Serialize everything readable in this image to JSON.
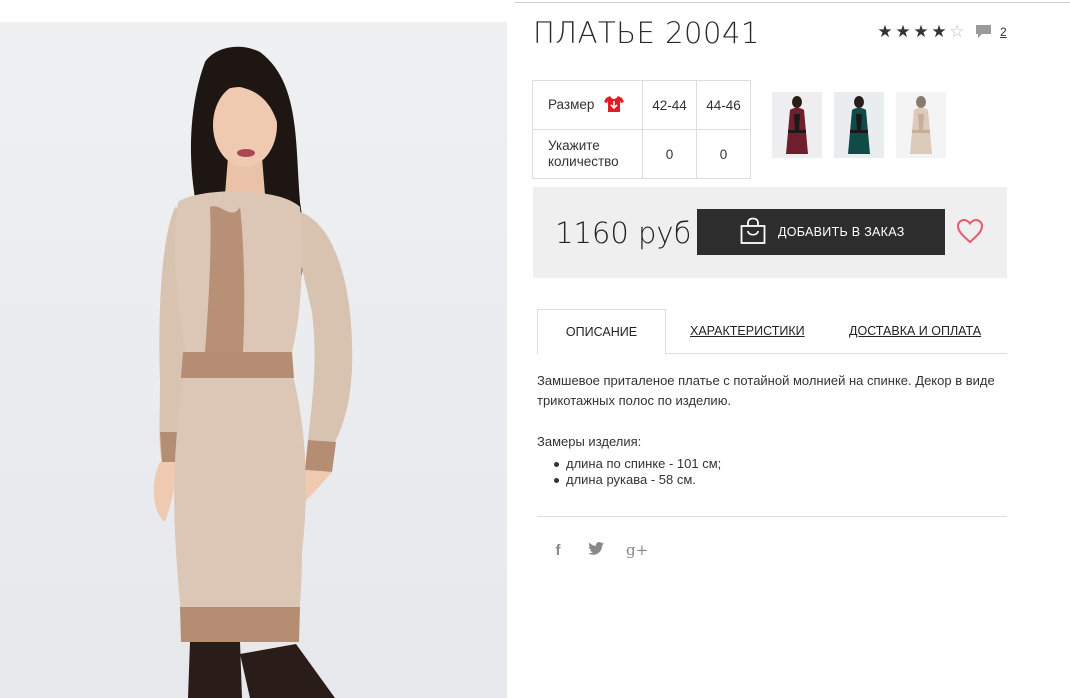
{
  "product": {
    "title": "ПЛАТЬЕ 20041",
    "rating": 4,
    "rating_max": 5,
    "comments_count": "2"
  },
  "size_table": {
    "size_label": "Размер",
    "sizes": [
      "42-44",
      "44-46"
    ],
    "quantity_label_line1": "Укажите",
    "quantity_label_line2": "количество",
    "quantities": [
      "0",
      "0"
    ]
  },
  "thumbnails": [
    {
      "name": "burgundy-dress",
      "color": "#6e1e2c"
    },
    {
      "name": "green-dress",
      "color": "#114b48"
    },
    {
      "name": "beige-dress",
      "color": "#d9c8b6"
    }
  ],
  "purchase": {
    "price": "1160 руб",
    "add_button_label": "ДОБАВИТЬ В ЗАКАЗ",
    "wishlist_icon": "heart-icon",
    "accent_color": "#e25a6e"
  },
  "tabs": [
    {
      "label": "ОПИСАНИЕ",
      "active": true
    },
    {
      "label": "ХАРАКТЕРИСТИКИ",
      "active": false
    },
    {
      "label": "ДОСТАВКА И ОПЛАТА",
      "active": false
    }
  ],
  "description": {
    "text": "Замшевое приталеное платье с потайной молнией на спинке. Декор в виде трикотажных полос по изделию.",
    "measures_title": "Замеры изделия:",
    "measures": [
      "длина по спинке - 101 см;",
      "длина рукава - 58 см."
    ]
  },
  "social": {
    "facebook": "f",
    "twitter": "twitter-icon",
    "googleplus": "g+"
  }
}
